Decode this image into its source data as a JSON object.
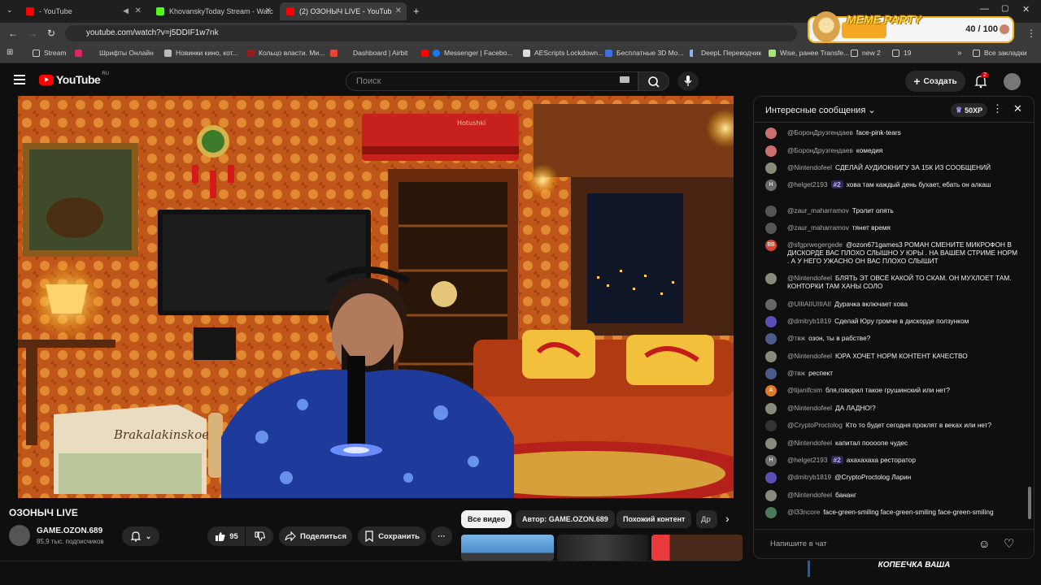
{
  "browser": {
    "tabs": [
      {
        "title": "- YouTube",
        "active": false
      },
      {
        "title": "KhovanskyToday Stream - Watc",
        "active": false
      },
      {
        "title": "(2) ОЗОНЫЧ LIVE - YouTub",
        "active": true
      }
    ],
    "url": "youtube.com/watch?v=j5DDIF1w7nk",
    "bookmarks": [
      "Stream",
      "Шрифты Онлайн",
      "Новинки кино, кот...",
      "Кольцо власти. Ми...",
      "Dashboard | Airbit",
      "Messenger | Facebo...",
      "AEScripts Lockdown...",
      "Бесплатные 3D Mo...",
      "DeepL Переводчик",
      "Wise, ранее Transfe...",
      "new 2",
      "19"
    ],
    "all_bookmarks": "Все закладки"
  },
  "meme_widget": {
    "title": "MEME PARTY",
    "count": "40 / 100"
  },
  "youtube": {
    "logo": "YouTube",
    "region": "RU",
    "search_placeholder": "Поиск",
    "create_label": "Создать",
    "notif_count": "2"
  },
  "video": {
    "title": "ОЗОНЫЧ LIVE",
    "box_text": "Brakalakinskoe",
    "ac_text": "Hotushki"
  },
  "channel": {
    "name": "GAME.OZON.689",
    "subs": "85,9 тыс. подписчиков",
    "likes": "95",
    "share_label": "Поделиться",
    "save_label": "Сохранить"
  },
  "chips": [
    "Все видео",
    "Автор: GAME.OZON.689",
    "Похожий контент",
    "Др"
  ],
  "chat": {
    "header": "Интересные сообщения",
    "xp": "50XP",
    "input_placeholder": "Напишите в чат",
    "messages": [
      {
        "author": "@БоронДрузгендаев",
        "badge": "",
        "text": "face-pink-tears",
        "color": "#c96f6f",
        "init": ""
      },
      {
        "author": "@БоронДрузгендаев",
        "badge": "",
        "text": "комедия",
        "color": "#c96f6f",
        "init": ""
      },
      {
        "author": "@Nintendofeel",
        "badge": "",
        "text": "СДЕЛАЙ АУДИОКНИГУ ЗА 15К ИЗ СООБЩЕНИЙ",
        "color": "#8a8a7a",
        "init": ""
      },
      {
        "author": "@helget2193",
        "badge": "#2",
        "text": "хова там каждый день бухает, ебать он алкаш",
        "color": "#6b6b6b",
        "init": "H"
      },
      {
        "author": "@zaur_maharramov",
        "badge": "",
        "text": "Тролит опять",
        "color": "#555",
        "init": ""
      },
      {
        "author": "@zaur_maharramov",
        "badge": "",
        "text": "тянет время",
        "color": "#555",
        "init": ""
      },
      {
        "author": "@sfgprwegergede",
        "badge": "",
        "text": "@ozon671games3 РОМАН СМЕНИТЕ МИКРОФОН В ДИСКОРДЕ ВАС ПЛОХО СЛЫШНО У ЮРЫ . НА ВАШЕМ СТРИМЕ НОРМ . А У НЕГО УЖАСНО ОН ВАС ПЛОХО СЛЫШИТ",
        "color": "#d6452f",
        "init": "BB"
      },
      {
        "author": "@Nintendofeel",
        "badge": "",
        "text": "БЛЯТЬ ЭТ ОВСЁ КАКОЙ ТО СКАМ. ОН МУХЛОЕТ ТАМ. КОНТОРКИ ТАМ ХАНЫ СОЛО",
        "color": "#8a8a7a",
        "init": ""
      },
      {
        "author": "@UlIIAIIUIIIAII",
        "badge": "",
        "text": "Дурачка включает хова",
        "color": "#666",
        "init": ""
      },
      {
        "author": "@dmitryb1819",
        "badge": "",
        "text": "Сделай Юру громче в дискорде ползунком",
        "color": "#5a4fb5",
        "init": ""
      },
      {
        "author": "@твж",
        "badge": "",
        "text": "озон, ты в рабстве?",
        "color": "#4a5a8a",
        "init": ""
      },
      {
        "author": "@Nintendofeel",
        "badge": "",
        "text": "ЮРА ХОЧЕТ НОРМ КОНТЕНТ КАЧЕСТВО",
        "color": "#8a8a7a",
        "init": ""
      },
      {
        "author": "@твж",
        "badge": "",
        "text": "респект",
        "color": "#4a5a8a",
        "init": ""
      },
      {
        "author": "@tijanifcsm",
        "badge": "",
        "text": "бля,говорил такое грушинский или нет?",
        "color": "#e07a2a",
        "init": "A"
      },
      {
        "author": "@Nintendofeel",
        "badge": "",
        "text": "ДА ЛАДНО!?",
        "color": "#8a8a7a",
        "init": ""
      },
      {
        "author": "@CryptoProctolog",
        "badge": "",
        "text": "Кто то будет сегодня проклят в веках или нет?",
        "color": "#333",
        "init": ""
      },
      {
        "author": "@Nintendofeel",
        "badge": "",
        "text": "капитал поооопе чудес",
        "color": "#8a8a7a",
        "init": ""
      },
      {
        "author": "@helget2193",
        "badge": "#2",
        "text": "ахахахаха ресторатор",
        "color": "#6b6b6b",
        "init": "H"
      },
      {
        "author": "@dmitryb1819",
        "badge": "",
        "text": "@CryptoProctolog Ларин",
        "color": "#5a4fb5",
        "init": ""
      },
      {
        "author": "@Nintendofeel",
        "badge": "",
        "text": "бананг",
        "color": "#8a8a7a",
        "init": ""
      },
      {
        "author": "@l33ncore",
        "badge": "",
        "text": "face-green-smiling face-green-smiling face-green-smiling",
        "color": "#4a7a5a",
        "init": ""
      }
    ]
  },
  "overlay_text": "КОПЕЕЧКА ВАША"
}
